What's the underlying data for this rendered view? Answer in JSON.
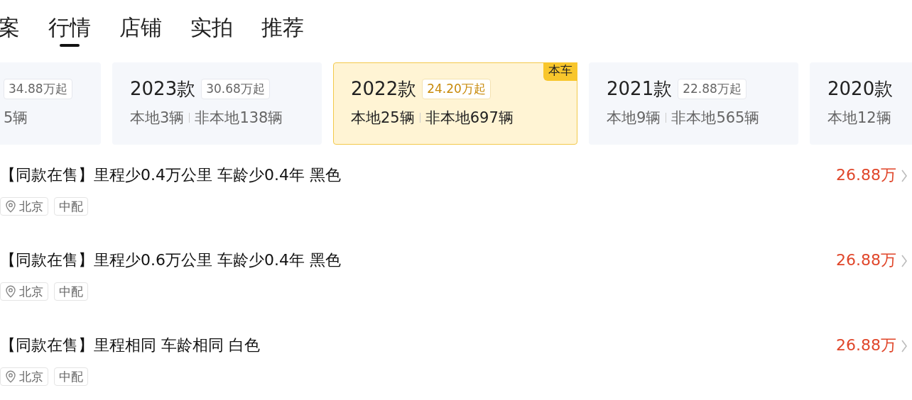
{
  "tabs": [
    {
      "label": "案",
      "selected": false
    },
    {
      "label": "行情",
      "selected": true
    },
    {
      "label": "店铺",
      "selected": false
    },
    {
      "label": "实拍",
      "selected": false
    },
    {
      "label": "推荐",
      "selected": false
    }
  ],
  "cards": [
    {
      "price": "34.88万起",
      "local": "5辆",
      "selected": false
    },
    {
      "title": "2023款",
      "price": "30.68万起",
      "local": "本地3辆",
      "nonlocal": "非本地138辆",
      "selected": false
    },
    {
      "title": "2022款",
      "price": "24.20万起",
      "local": "本地25辆",
      "nonlocal": "非本地697辆",
      "selected": true,
      "badge": "本车"
    },
    {
      "title": "2021款",
      "price": "22.88万起",
      "local": "本地9辆",
      "nonlocal": "非本地565辆",
      "selected": false
    },
    {
      "title": "2020款",
      "local": "本地12辆",
      "selected": false
    }
  ],
  "listings": [
    {
      "title": "【同款在售】里程少0.4万公里 车龄少0.4年 黑色",
      "location": "北京",
      "trim": "中配",
      "price": "26.88万"
    },
    {
      "title": "【同款在售】里程少0.6万公里 车龄少0.4年 黑色",
      "location": "北京",
      "trim": "中配",
      "price": "26.88万"
    },
    {
      "title": "【同款在售】里程相同 车龄相同 白色",
      "location": "北京",
      "trim": "中配",
      "price": "26.88万"
    }
  ]
}
